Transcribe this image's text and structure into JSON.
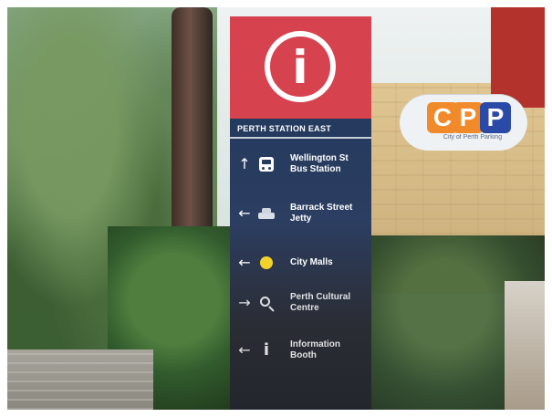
{
  "scene": {
    "main_sign": {
      "top_icon": "info-icon",
      "header": "PERTH STATION EAST",
      "rows": [
        {
          "arrow": "↑",
          "pictogram": "bus-icon",
          "label": "Wellington St\nBus Station"
        },
        {
          "arrow": "←",
          "pictogram": "ferry-icon",
          "label": "Barrack Street\nJetty"
        },
        {
          "arrow": "←",
          "pictogram": "city-malls-dot-icon",
          "label": "City Malls"
        },
        {
          "arrow": "→",
          "pictogram": "cultural-centre-icon",
          "label": "Perth Cultural\nCentre"
        },
        {
          "arrow": "←",
          "pictogram": "information-icon",
          "label": "Information\nBooth"
        }
      ],
      "colors": {
        "top": "#d7424f",
        "panel": "#243a5e",
        "accent_yellow": "#f2d22b"
      }
    },
    "parking_sign": {
      "letters": [
        "C",
        "P",
        "P"
      ],
      "subtext": "City of Perth Parking",
      "colors": {
        "orange": "#f08a2a",
        "blue": "#2b4aa7"
      }
    }
  }
}
